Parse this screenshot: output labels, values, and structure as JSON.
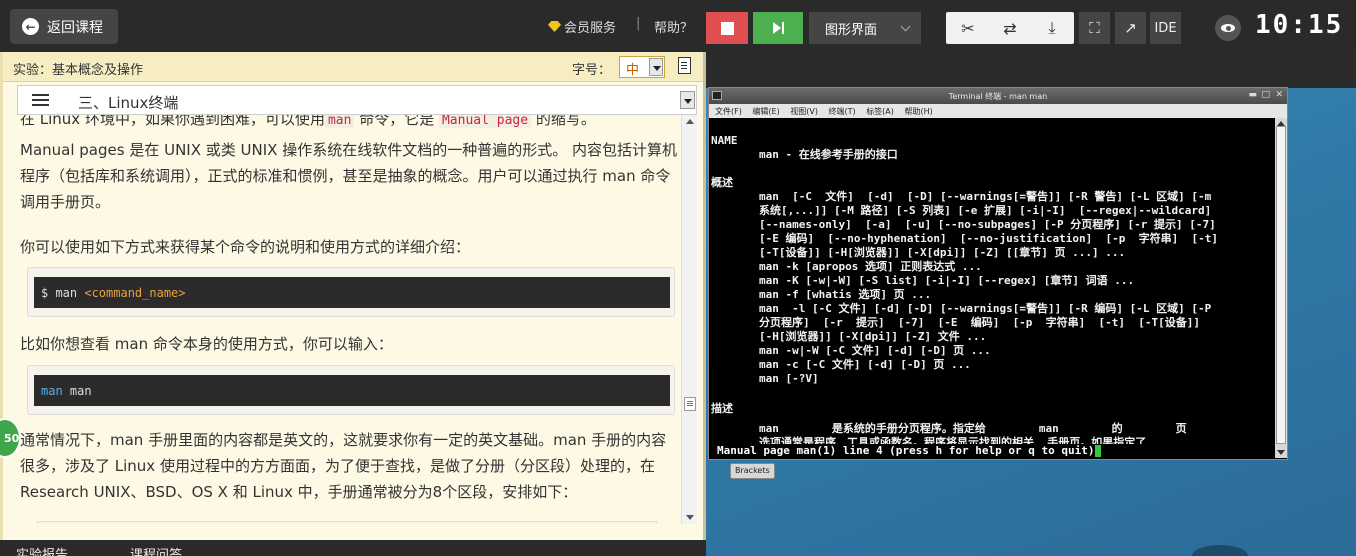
{
  "topbar": {
    "back_label": "返回课程",
    "member_label": "会员服务",
    "divider": "|",
    "help_label": "帮助？",
    "mode_select": "图形界面",
    "ide_label": "IDE",
    "clock": "10:15"
  },
  "lab": {
    "title": "实验：基本概念及操作",
    "font_label": "字号：",
    "font_value": "中",
    "toc_title": "三、Linux终端"
  },
  "content": {
    "p1_pre": "在 Linux 环境中，如果你遇到困难，可以使用",
    "p1_code1": "man",
    "p1_mid": " 命令，它是 ",
    "p1_code2": "Manual page",
    "p1_post": " 的缩写。",
    "p2": "Manual pages 是在 UNIX 或类 UNIX 操作系统在线软件文档的一种普遍的形式。 内容包括计算机程序（包括库和系统调用），正式的标准和惯例，甚至是抽象的概念。用户可以通过执行 man 命令调用手册页。",
    "p3": "你可以使用如下方式来获得某个命令的说明和使用方式的详细介绍：",
    "code1_prompt": "$ man ",
    "code1_arg": "<command_name>",
    "p4": "比如你想查看 man 命令本身的使用方式，你可以输入：",
    "code2_cmd": "man",
    "code2_arg": " man",
    "p5": "通常情况下，man 手册里面的内容都是英文的，这就要求你有一定的英文基础。man 手册的内容很多，涉及了 Linux 使用过程中的方方面面，为了便于查找，是做了分册（分区段）处理的，在Research UNIX、BSD、OS X 和 Linux 中，手册通常被分为8个区段，安排如下：",
    "badge": "50"
  },
  "bottom_tabs": [
    "实验报告",
    "课程问答"
  ],
  "terminal": {
    "title": "Terminal 终端 - man man",
    "menu": [
      "文件(F)",
      "编辑(E)",
      "视图(V)",
      "终端(T)",
      "标签(A)",
      "帮助(H)"
    ],
    "lines": [
      {
        "text": "NAME",
        "ind": false
      },
      {
        "text": "man - 在线参考手册的接口",
        "ind": true
      },
      {
        "text": "概述",
        "ind": false
      },
      {
        "text": "man  [-C  文件]  [-d]  [-D] [--warnings[=警告]] [-R 警告] [-L 区域] [-m",
        "ind": true
      },
      {
        "text": "系统[,...]] [-M 路径] [-S 列表] [-e 扩展] [-i|-I]  [--regex|--wildcard]",
        "ind": true
      },
      {
        "text": "[--names-only]  [-a]  [-u] [--no-subpages] [-P 分页程序] [-r 提示] [-7]",
        "ind": true
      },
      {
        "text": "[-E 编码]  [--no-hyphenation]  [--no-justification]  [-p  字符串]  [-t]",
        "ind": true
      },
      {
        "text": "[-T[设备]] [-H[浏览器]] [-X[dpi]] [-Z] [[章节] 页 ...] ...",
        "ind": true
      },
      {
        "text": "man -k [apropos 选项] 正则表达式 ...",
        "ind": true
      },
      {
        "text": "man -K [-w|-W] [-S list] [-i|-I] [--regex] [章节] 词语 ...",
        "ind": true
      },
      {
        "text": "man -f [whatis 选项] 页 ...",
        "ind": true
      },
      {
        "text": "man  -l [-C 文件] [-d] [-D] [--warnings[=警告]] [-R 编码] [-L 区域] [-P",
        "ind": true
      },
      {
        "text": "分页程序]  [-r  提示]  [-7]  [-E  编码]  [-p  字符串]  [-t]  [-T[设备]]",
        "ind": true
      },
      {
        "text": "[-H[浏览器]] [-X[dpi]] [-Z] 文件 ...",
        "ind": true
      },
      {
        "text": "man -w|-W [-C 文件] [-d] [-D] 页 ...",
        "ind": true
      },
      {
        "text": "man -c [-C 文件] [-d] [-D] 页 ...",
        "ind": true
      },
      {
        "text": "man [-?V]",
        "ind": true
      },
      {
        "text": "描述",
        "ind": false
      },
      {
        "text": "man        是系统的手册分页程序。指定给        man        的        页",
        "ind": true
      },
      {
        "text": "选项通常是程序、工具或函数名。程序将显示找到的相关  手册页。如果指定了",
        "ind": true
      }
    ],
    "status": "Manual page man(1) line 4 (press h for help or q to quit)"
  },
  "tooltip": "Brackets"
}
